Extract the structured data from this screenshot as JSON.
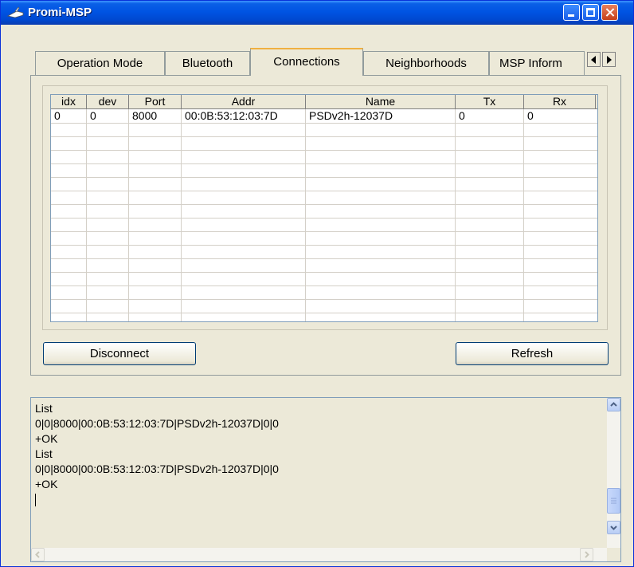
{
  "window": {
    "title": "Promi-MSP",
    "controls": {
      "minimize": "minimize",
      "maximize": "maximize",
      "close": "close"
    }
  },
  "tabs": [
    {
      "label": "Operation Mode",
      "active": false
    },
    {
      "label": "Bluetooth",
      "active": false
    },
    {
      "label": "Connections",
      "active": true
    },
    {
      "label": "Neighborhoods",
      "active": false
    },
    {
      "label": "MSP Inform",
      "active": false
    }
  ],
  "table": {
    "columns": [
      "idx",
      "dev",
      "Port",
      "Addr",
      "Name",
      "Tx",
      "Rx"
    ],
    "rows": [
      [
        "0",
        "0",
        "8000",
        "00:0B:53:12:03:7D",
        "PSDv2h-12037D",
        "0",
        "0"
      ]
    ]
  },
  "buttons": {
    "disconnect": "Disconnect",
    "refresh": "Refresh"
  },
  "log": {
    "lines": [
      "List",
      "0|0|8000|00:0B:53:12:03:7D|PSDv2h-12037D|0|0",
      "+OK",
      "List",
      "0|0|8000|00:0B:53:12:03:7D|PSDv2h-12037D|0|0",
      "+OK"
    ]
  },
  "icons": {
    "app": "app-icon",
    "tab_scroll_left": "chevron-left-icon",
    "tab_scroll_right": "chevron-right-icon"
  }
}
